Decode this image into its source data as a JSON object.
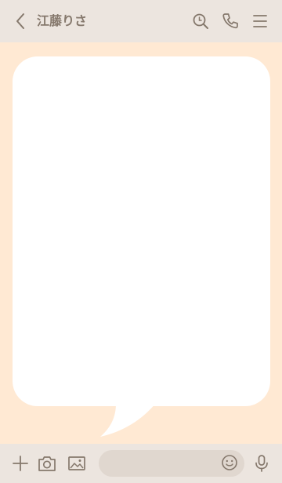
{
  "header": {
    "chat_name": "江藤りさ",
    "icons": [
      "back-chevron-icon",
      "search-icon",
      "phone-icon",
      "menu-icon"
    ]
  },
  "footer": {
    "message_placeholder": "",
    "icons": [
      "plus-icon",
      "camera-icon",
      "image-icon",
      "emoji-icon",
      "mic-icon"
    ]
  },
  "colors": {
    "background": "#ffe9d3",
    "bars": "#ece5df",
    "icon": "#85786c",
    "bubble": "#ffffff",
    "input": "#e0d7cf"
  }
}
